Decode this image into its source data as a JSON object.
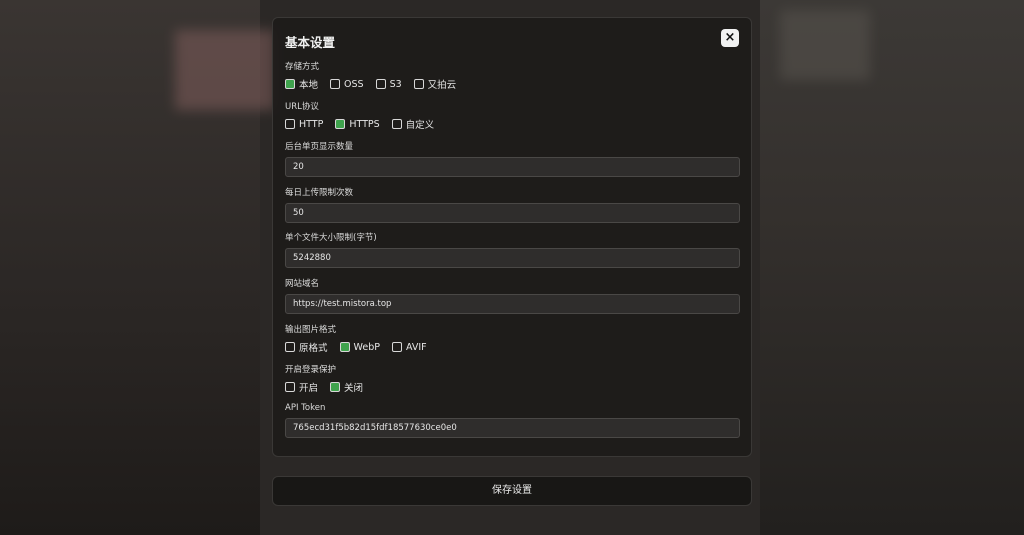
{
  "dialog": {
    "title": "基本设置",
    "close_icon": "×"
  },
  "storage": {
    "label": "存储方式",
    "options": [
      {
        "label": "本地",
        "checked": true
      },
      {
        "label": "OSS",
        "checked": false
      },
      {
        "label": "S3",
        "checked": false
      },
      {
        "label": "又拍云",
        "checked": false
      }
    ]
  },
  "url_protocol": {
    "label": "URL协议",
    "options": [
      {
        "label": "HTTP",
        "checked": false
      },
      {
        "label": "HTTPS",
        "checked": true
      },
      {
        "label": "自定义",
        "checked": false
      }
    ]
  },
  "page_size": {
    "label": "后台单页显示数量",
    "value": "20"
  },
  "daily_limit": {
    "label": "每日上传限制次数",
    "value": "50"
  },
  "file_size_limit": {
    "label": "单个文件大小限制(字节)",
    "value": "5242880"
  },
  "domain": {
    "label": "网站域名",
    "value": "https://test.mistora.top"
  },
  "output_format": {
    "label": "输出图片格式",
    "options": [
      {
        "label": "原格式",
        "checked": false
      },
      {
        "label": "WebP",
        "checked": true
      },
      {
        "label": "AVIF",
        "checked": false
      }
    ]
  },
  "login_protection": {
    "label": "开启登录保护",
    "options": [
      {
        "label": "开启",
        "checked": false
      },
      {
        "label": "关闭",
        "checked": true
      }
    ]
  },
  "api_token": {
    "label": "API Token",
    "value": "765ecd31f5b82d15fdf18577630ce0e0"
  },
  "save_label": "保存设置",
  "colors": {
    "checked": "#3fa34d",
    "background": "#2b2826"
  }
}
